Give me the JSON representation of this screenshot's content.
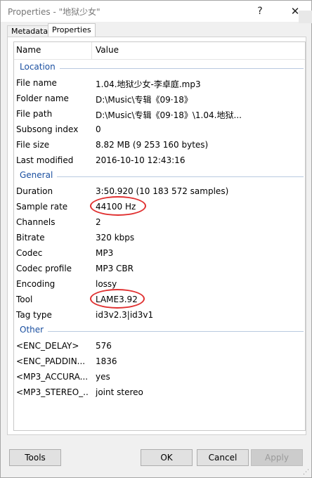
{
  "window": {
    "title": "Properties - \"地狱少女\"",
    "help_glyph": "?",
    "close_glyph": "✕"
  },
  "tabs": [
    {
      "label": "Metadata"
    },
    {
      "label": "Properties"
    }
  ],
  "list": {
    "header": {
      "name": "Name",
      "value": "Value"
    },
    "groups": [
      {
        "label": "Location",
        "rows": [
          {
            "name": "File name",
            "value": "1.04.地狱少女-李卓庭.mp3"
          },
          {
            "name": "Folder name",
            "value": "D:\\Music\\专辑《09·18》"
          },
          {
            "name": "File path",
            "value": "D:\\Music\\专辑《09·18》\\1.04.地狱..."
          },
          {
            "name": "Subsong index",
            "value": "0"
          },
          {
            "name": "File size",
            "value": "8.82 MB (9 253 160 bytes)"
          },
          {
            "name": "Last modified",
            "value": "2016-10-10 12:43:16"
          }
        ]
      },
      {
        "label": "General",
        "rows": [
          {
            "name": "Duration",
            "value": "3:50.920 (10 183 572 samples)"
          },
          {
            "name": "Sample rate",
            "value": "44100 Hz"
          },
          {
            "name": "Channels",
            "value": "2"
          },
          {
            "name": "Bitrate",
            "value": "320 kbps"
          },
          {
            "name": "Codec",
            "value": "MP3"
          },
          {
            "name": "Codec profile",
            "value": "MP3 CBR"
          },
          {
            "name": "Encoding",
            "value": "lossy"
          },
          {
            "name": "Tool",
            "value": "LAME3.92"
          },
          {
            "name": "Tag type",
            "value": "id3v2.3|id3v1"
          }
        ]
      },
      {
        "label": "Other",
        "rows": [
          {
            "name": "<ENC_DELAY>",
            "value": "576"
          },
          {
            "name": "<ENC_PADDIN...",
            "value": "1836"
          },
          {
            "name": "<MP3_ACCURA...",
            "value": "yes"
          },
          {
            "name": "<MP3_STEREO_...",
            "value": "joint stereo"
          }
        ]
      }
    ]
  },
  "buttons": {
    "tools": "Tools",
    "ok": "OK",
    "cancel": "Cancel",
    "apply": "Apply"
  },
  "annotation_color": "#e03030",
  "group_color": "#1a4fa0"
}
